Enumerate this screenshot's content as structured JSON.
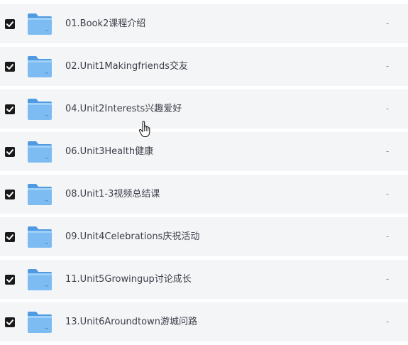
{
  "file_list": {
    "items": [
      {
        "name": "01.Book2课程介绍",
        "size": "-",
        "checked": true,
        "icon": "folder-icon"
      },
      {
        "name": "02.Unit1Makingfriends交友",
        "size": "-",
        "checked": true,
        "icon": "folder-icon"
      },
      {
        "name": "04.Unit2Interests兴趣爱好",
        "size": "-",
        "checked": true,
        "icon": "folder-icon"
      },
      {
        "name": "06.Unit3Health健康",
        "size": "-",
        "checked": true,
        "icon": "folder-icon"
      },
      {
        "name": "08.Unit1-3视频总结课",
        "size": "-",
        "checked": true,
        "icon": "folder-icon"
      },
      {
        "name": "09.Unit4Celebrations庆祝活动",
        "size": "-",
        "checked": true,
        "icon": "folder-icon"
      },
      {
        "name": "11.Unit5Growingup讨论成长",
        "size": "-",
        "checked": true,
        "icon": "folder-icon"
      },
      {
        "name": "13.Unit6Aroundtown游城问路",
        "size": "-",
        "checked": true,
        "icon": "folder-icon"
      }
    ]
  },
  "colors": {
    "row_background": "#f4f5f7",
    "checkbox": "#1a1a1a",
    "folder_blue": "#5fa8e8",
    "folder_front": "#7cbcf2",
    "text": "#3c4049",
    "muted": "#8f939b"
  },
  "cursor": {
    "icon": "hand-pointer-icon"
  }
}
